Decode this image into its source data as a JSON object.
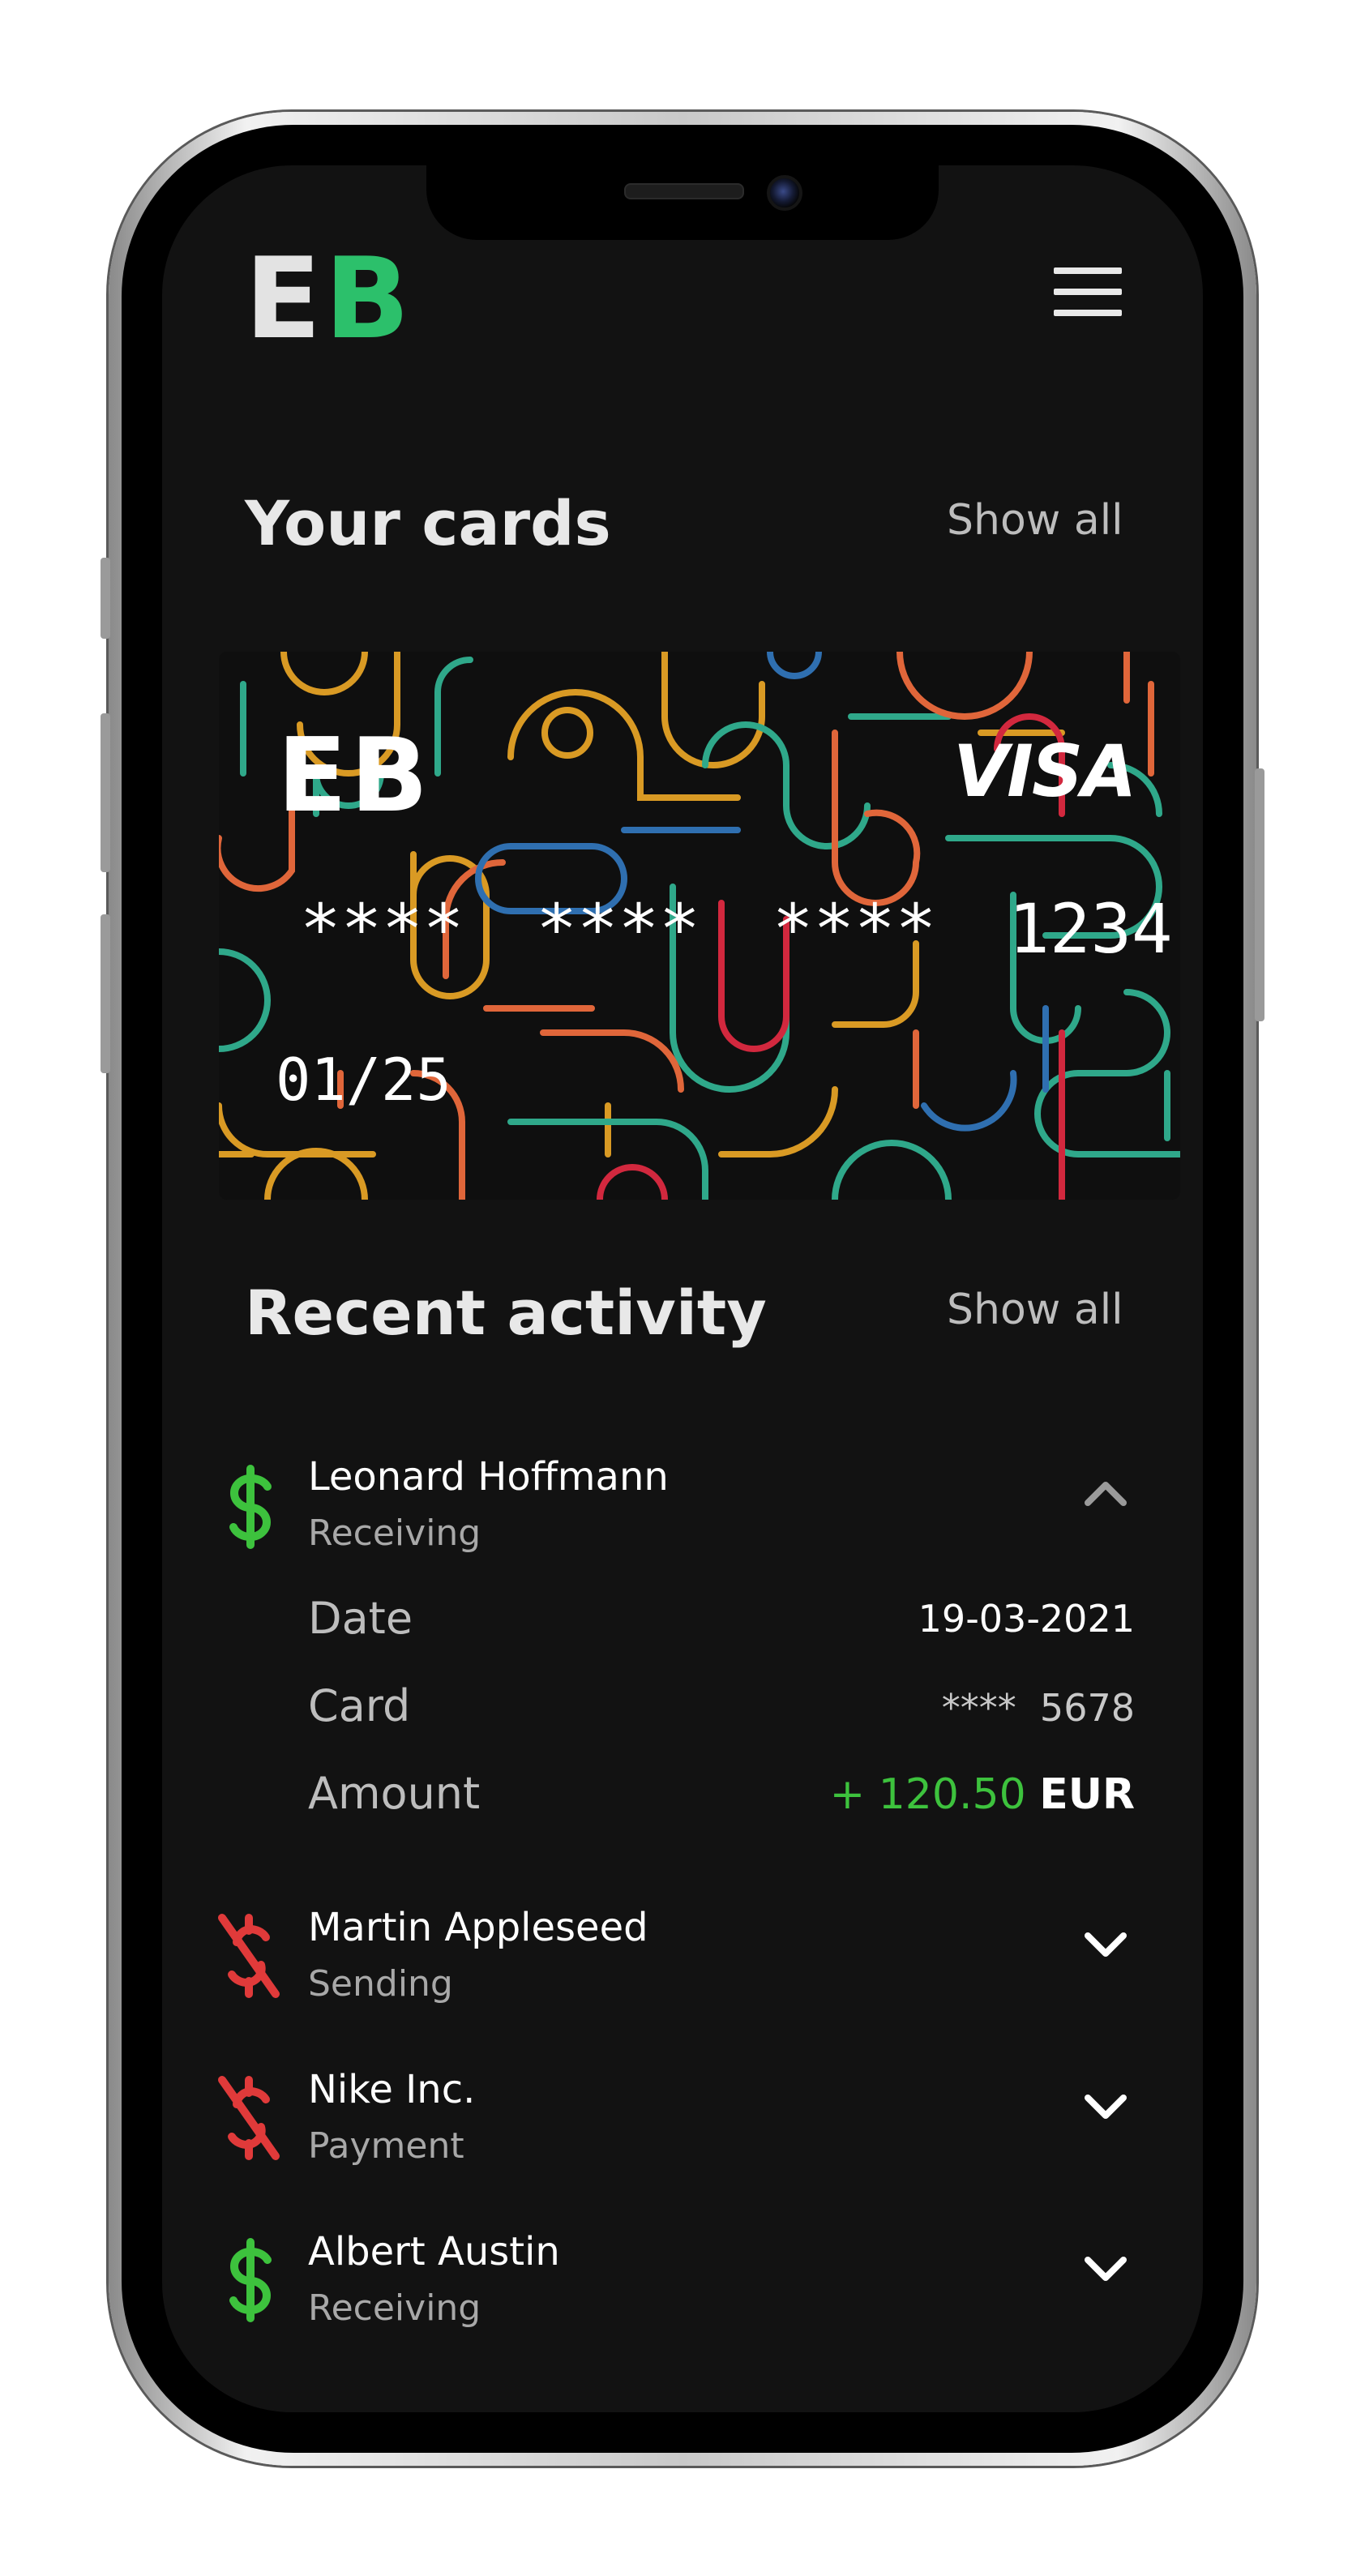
{
  "header": {
    "logo_first": "E",
    "logo_second": "B",
    "menu_icon": "hamburger-menu-icon"
  },
  "cards_section": {
    "title": "Your cards",
    "show_all": "Show all"
  },
  "card": {
    "logo": "EB",
    "network": "VISA",
    "number": "****  ****  ****  1234",
    "expiry": "01/25"
  },
  "activity_section": {
    "title": "Recent activity",
    "show_all": "Show all"
  },
  "transactions": [
    {
      "name": "Leonard Hoffmann",
      "type": "Receiving",
      "icon": "dollar-icon",
      "expanded": true,
      "details": {
        "date_label": "Date",
        "date_value": "19-03-2021",
        "card_label": "Card",
        "card_value": "****  5678",
        "amount_label": "Amount",
        "amount_value": "+ 120.50",
        "amount_currency": "EUR"
      }
    },
    {
      "name": "Martin Appleseed",
      "type": "Sending",
      "icon": "dollar-off-icon",
      "expanded": false
    },
    {
      "name": "Nike Inc.",
      "type": "Payment",
      "icon": "dollar-off-icon",
      "expanded": false
    },
    {
      "name": "Albert Austin",
      "type": "Receiving",
      "icon": "dollar-icon",
      "expanded": false
    }
  ],
  "colors": {
    "background": "#121212",
    "brand_green": "#2cc06b",
    "receiving_green": "#3dc23d",
    "sending_red": "#e03a3a",
    "muted_text": "#a8a8a8"
  }
}
